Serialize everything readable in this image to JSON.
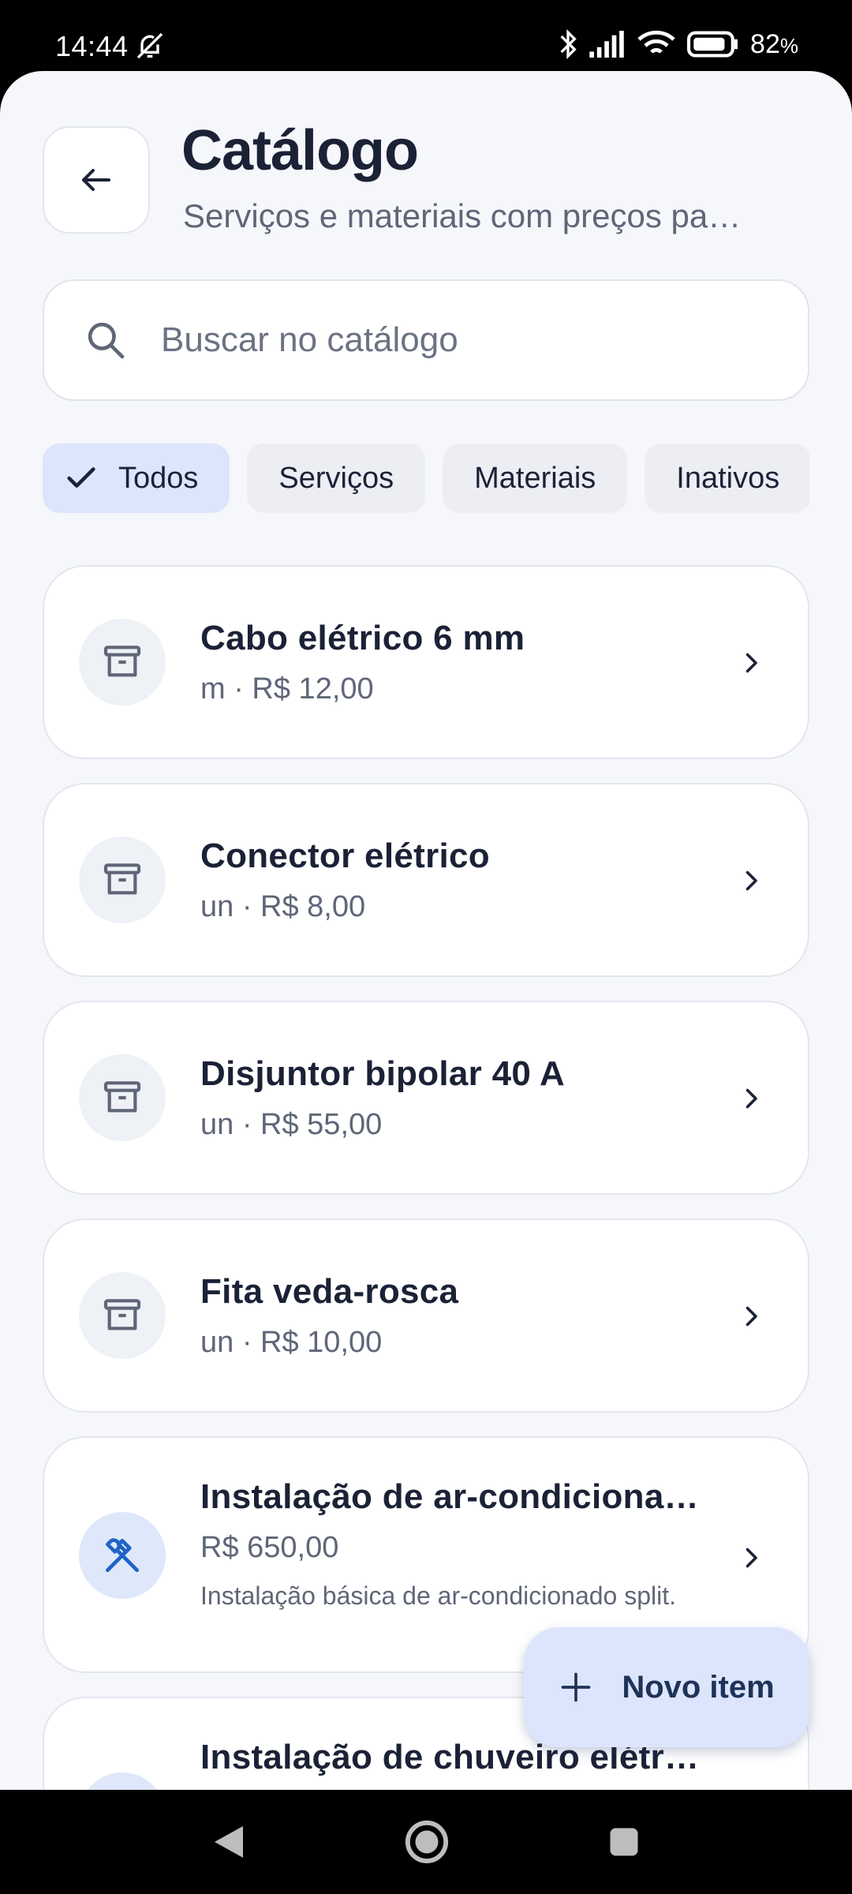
{
  "status_bar": {
    "time": "14:44",
    "battery": "82",
    "battery_unit": "%"
  },
  "header": {
    "title": "Catálogo",
    "subtitle": "Serviços e materiais com preços pa…"
  },
  "search": {
    "placeholder": "Buscar no catálogo"
  },
  "filters": [
    {
      "label": "Todos",
      "selected": true
    },
    {
      "label": "Serviços",
      "selected": false
    },
    {
      "label": "Materiais",
      "selected": false
    },
    {
      "label": "Inativos",
      "selected": false
    }
  ],
  "items": [
    {
      "name": "Cabo elétrico 6 mm",
      "meta": "m · R$ 12,00",
      "icon": "archive-icon"
    },
    {
      "name": "Conector elétrico",
      "meta": "un · R$ 8,00",
      "icon": "archive-icon"
    },
    {
      "name": "Disjuntor bipolar 40 A",
      "meta": "un · R$ 55,00",
      "icon": "archive-icon"
    },
    {
      "name": "Fita veda-rosca",
      "meta": "un · R$ 10,00",
      "icon": "archive-icon"
    },
    {
      "name": "Instalação de ar-condicionado split",
      "meta": "R$ 650,00",
      "description": "Instalação básica de ar-condicionado split.",
      "icon": "tools-icon"
    },
    {
      "name": "Instalação de chuveiro elétrico",
      "icon": "tools-icon"
    }
  ],
  "fab": {
    "label": "Novo item"
  },
  "colors": {
    "accent": "#dce5fc",
    "tool_icon": "#1f63c6",
    "text_primary": "#1b2236",
    "text_secondary": "#5f6678"
  }
}
